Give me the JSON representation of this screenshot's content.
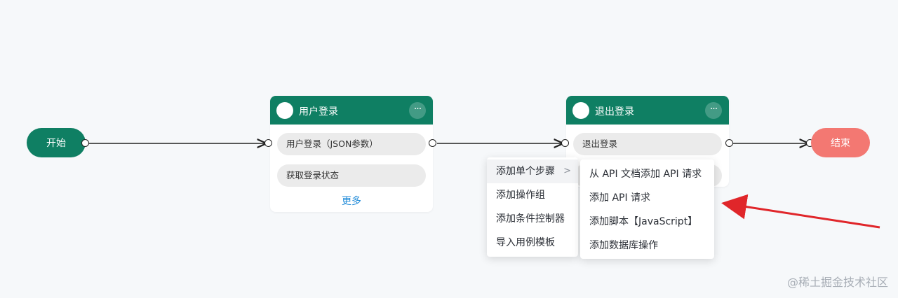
{
  "flow": {
    "start_label": "开始",
    "end_label": "结束",
    "nodes": [
      {
        "title": "用户登录",
        "menu_icon": "ellipsis-icon",
        "steps": [
          "用户登录（JSON参数）",
          "获取登录状态"
        ],
        "more_label": "更多"
      },
      {
        "title": "退出登录",
        "menu_icon": "ellipsis-icon",
        "steps": [
          "退出登录"
        ]
      }
    ]
  },
  "context_menu": {
    "items": [
      "添加单个步骤",
      "添加操作组",
      "添加条件控制器",
      "导入用例模板"
    ],
    "submenu_chevron": ">",
    "submenu": [
      "从 API 文档添加 API 请求",
      "添加 API 请求",
      "添加脚本【JavaScript】",
      "添加数据库操作"
    ]
  },
  "watermark": "@稀土掘金技术社区",
  "colors": {
    "node_green": "#0f7f63",
    "end_red": "#f37872",
    "link_blue": "#1f8ad8",
    "annotation_arrow": "#e0262a"
  }
}
